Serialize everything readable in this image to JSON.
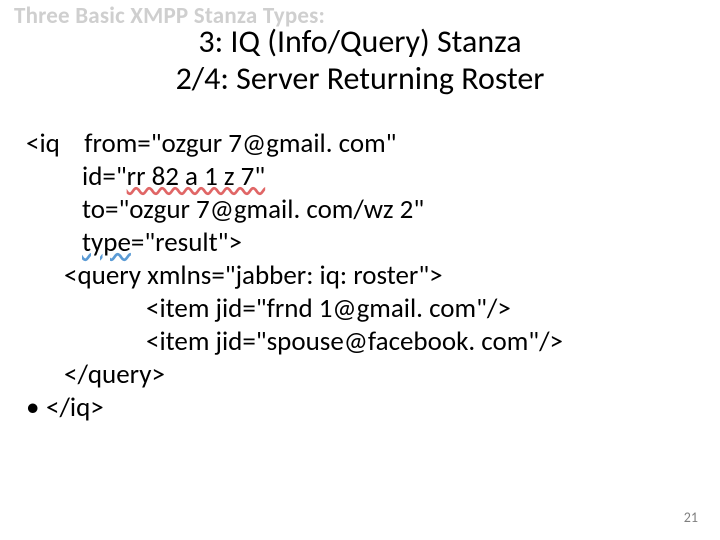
{
  "header": "Three Basic XMPP Stanza Types:",
  "title_line1": "3: IQ (Info/Query) Stanza",
  "title_line2": "2/4: Server Returning Roster",
  "code": {
    "l1a": "<iq",
    "l1b": "from=\"ozgur 7@gmail. com\"",
    "l2a": "id=\"",
    "l2b": "rr 82 a 1 z 7\"",
    "l3": "to=\"ozgur 7@gmail. com/wz 2\"",
    "l4a": "type",
    "l4b": "=\"result\">",
    "l5": "<query xmlns=\"jabber: iq: roster\">",
    "l6": "<item jid=\"frnd 1@gmail. com\"/>",
    "l7": "<item jid=\"spouse@facebook. com\"/>",
    "l8": "</query>",
    "l9": "</iq>"
  },
  "bullet": "•",
  "page_number": "21"
}
